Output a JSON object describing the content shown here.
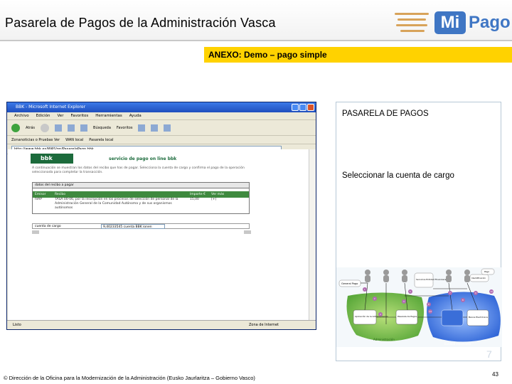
{
  "header": {
    "title": "Pasarela de Pagos de la Administración Vasca",
    "logo_mi": "Mi",
    "logo_pago": "Pago"
  },
  "section_bar": "ANEXO: Demo – pago simple",
  "browser": {
    "window_title": "BBK - Microsoft Internet Explorer",
    "menu": [
      "Archivo",
      "Edición",
      "Ver",
      "Favoritos",
      "Herramientas",
      "Ayuda"
    ],
    "toolbar": [
      "Atrás",
      "Búsqueda",
      "Favoritos"
    ],
    "links": [
      "Zonanoticias o Pruebas Ver",
      "WAN local",
      "Pasarela local"
    ],
    "address": "http://www.bbk.es/WAS/pp/PasarelaPago.bbk",
    "status_left": "Listo",
    "status_zone": "Zona de Internet",
    "page": {
      "bank_logo": "bbk",
      "heading": "servicio de pago on line bbk",
      "intro": "A continuación se muestran los datos del recibo que has de pagar. Selecciona la cuenta de cargo y confirma el pago de la operación seleccionada para completar la transacción.",
      "recibo_title": "datos del recibo a pagar",
      "recibo_headers": [
        "Emisor",
        "Recibo",
        "",
        "Importe €",
        "Ver más"
      ],
      "recibo_row": [
        "IVAP",
        "TASA 00-06, por la inscripción en los procesos de selección de personal de la Administración General de la Comunidad Autónoma y de sus organismos autónomos",
        "",
        "15,00",
        "[+]"
      ],
      "cuenta_label": "cuenta de cargo",
      "cuenta_value": "9,40233545 cuenta BBK ionen"
    }
  },
  "right_panel": {
    "title": "PASARELA DE PAGOS",
    "subtitle": "Seleccionar la cuenta de cargo",
    "diagram": {
      "general_label": "General Pago",
      "services": "Servicios Entidad Financiera",
      "identification": "Identificación",
      "pago": "Pago",
      "app": "Aplicación de la Administración",
      "pasarela": "Pasarela de Pagos",
      "banca": "Banca Electrónica",
      "admin_label": "Administración",
      "entidad": "Entidad Financiera",
      "steps": [
        "1",
        "2",
        "3",
        "4",
        "5",
        "6",
        "7",
        "8",
        "9",
        "10",
        "11"
      ]
    },
    "step_number": "7"
  },
  "footer": "© Dirección de la Oficina para la Modernización de la Administración (Eusko Jaurlaritza – Gobierno Vasco)",
  "page_number": "43",
  "colors": {
    "accent_yellow": "#ffd200",
    "mipago_blue": "#3f76c4",
    "bbk_green": "#1c6b3c"
  }
}
